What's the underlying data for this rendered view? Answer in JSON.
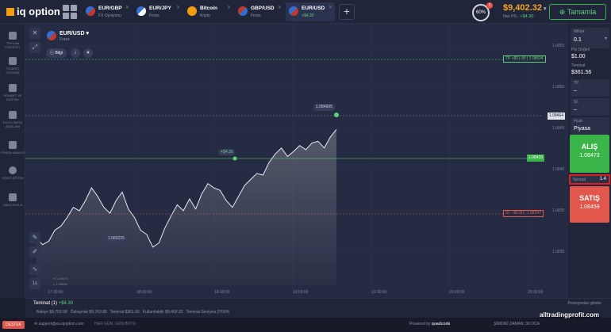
{
  "header": {
    "logo": "iq option",
    "tabs": [
      {
        "name": "EUR/GBP",
        "sub": "FX Opsiyonu",
        "active": false
      },
      {
        "name": "EUR/JPY",
        "sub": "Forex",
        "active": false
      },
      {
        "name": "Bitcoin",
        "sub": "Kripto",
        "active": false
      },
      {
        "name": "GBP/USD",
        "sub": "Forex",
        "active": false
      },
      {
        "name": "EUR/USD",
        "sub": "+$4.30",
        "active": true
      }
    ],
    "add_tab": "+",
    "gauge": "60%",
    "gauge_badge": "1",
    "balance": "$9,402.32",
    "net_pl_label": "Net P/L",
    "net_pl_value": "+$4.30",
    "deposit": "Tamamla"
  },
  "left_nav": [
    {
      "label": "TOPLAM PORTFÖY",
      "icon": "briefcase-icon"
    },
    {
      "label": "TİCARET GEÇMİŞİ",
      "icon": "history-icon"
    },
    {
      "label": "SOHBET VE DESTEK",
      "icon": "chat-icon"
    },
    {
      "label": "EN İYİ SATIŞ AKIŞLARI",
      "icon": "leaderboard-icon"
    },
    {
      "label": "PİYASA ANALİZİ",
      "icon": "analysis-icon"
    },
    {
      "label": "VİDEO EĞİTİM",
      "icon": "video-icon"
    },
    {
      "label": "DAHA FAZLA",
      "icon": "more-icon"
    }
  ],
  "chart": {
    "pair": "EUR/USD",
    "pair_sub": "Forex",
    "info": "Bilgi",
    "tp_label": "TP +$11.90",
    "tp_price": "1.08534",
    "sl_label": "SL −$6.80",
    "sl_price": "1.08347",
    "entry_price": "1.08415",
    "current_price": "1.08464",
    "entry_pl": "+$4.30",
    "high_label": "1.084695",
    "low_label": "1.083225",
    "high_mini": "H 1.08573",
    "low_mini": "L 1.08693",
    "timeframe": "1s",
    "time_ticks": [
      "17:30:00",
      "18:00:00",
      "18:30:00",
      "19:00:00",
      "19:30:00",
      "20:00:00",
      "20:30:00"
    ],
    "price_ticks": [
      "1.0855",
      "1.0850",
      "1.0845",
      "1.0840",
      "1.0835",
      "1.0830"
    ]
  },
  "chart_data": {
    "type": "line",
    "series": [
      {
        "values": [
          1.08335,
          1.08328,
          1.08332,
          1.08345,
          1.0835,
          1.0836,
          1.08372,
          1.08368,
          1.0838,
          1.08395,
          1.08385,
          1.08372,
          1.08365,
          1.0838,
          1.0839,
          1.0837,
          1.0836,
          1.08345,
          1.0834,
          1.08325,
          1.0833,
          1.08348,
          1.08362,
          1.08375,
          1.08368,
          1.08382,
          1.0837,
          1.08388,
          1.084,
          1.08395,
          1.08392,
          1.0838,
          1.08372,
          1.08385,
          1.08398,
          1.08405,
          1.08412,
          1.0841,
          1.08425,
          1.08435,
          1.08442,
          1.08432,
          1.08438,
          1.08445,
          1.0844,
          1.08448,
          1.0845,
          1.08442,
          1.08455,
          1.08464
        ]
      }
    ],
    "ylim": [
      1.0828,
      1.0857
    ]
  },
  "right_panel": {
    "amount_label": "Miktar",
    "amount_value": "0.1",
    "pip_label": "Pip Değeri",
    "pip_value": "$1.00",
    "margin_label": "Teminat",
    "margin_value": "$361.56",
    "tp_label": "TP",
    "tp_value": "–",
    "sl_label": "SL",
    "sl_value": "–",
    "price_label": "Fiyat",
    "price_value": "Piyasa",
    "buy_label": "ALIŞ",
    "buy_price": "1.08473",
    "spread_label": "Spread",
    "spread_value": "1.4",
    "sell_label": "SATIŞ",
    "sell_price": "1.08459"
  },
  "bottom": {
    "margin_tab": "Teminat (1)",
    "margin_tab_pl": "+$4.30",
    "positions_link": "Pozisyonları göster",
    "stats": "Bakiye $9,759.58   Özkaynak $9,763.88   Teminat $361.56   Kullanılabilir $9,402.32   Teminat Seviyesi 2700%",
    "support": "support@eu.iqoption.com",
    "slogan": "HER GÜN, GÜN BOYU",
    "destek": "DESTEK",
    "powered": "Powered by",
    "quadcode": "quadcode",
    "clock": "ŞİMDİKİ ZAMAN: 30 OCA",
    "watermark": "alltradingprofit.com"
  }
}
